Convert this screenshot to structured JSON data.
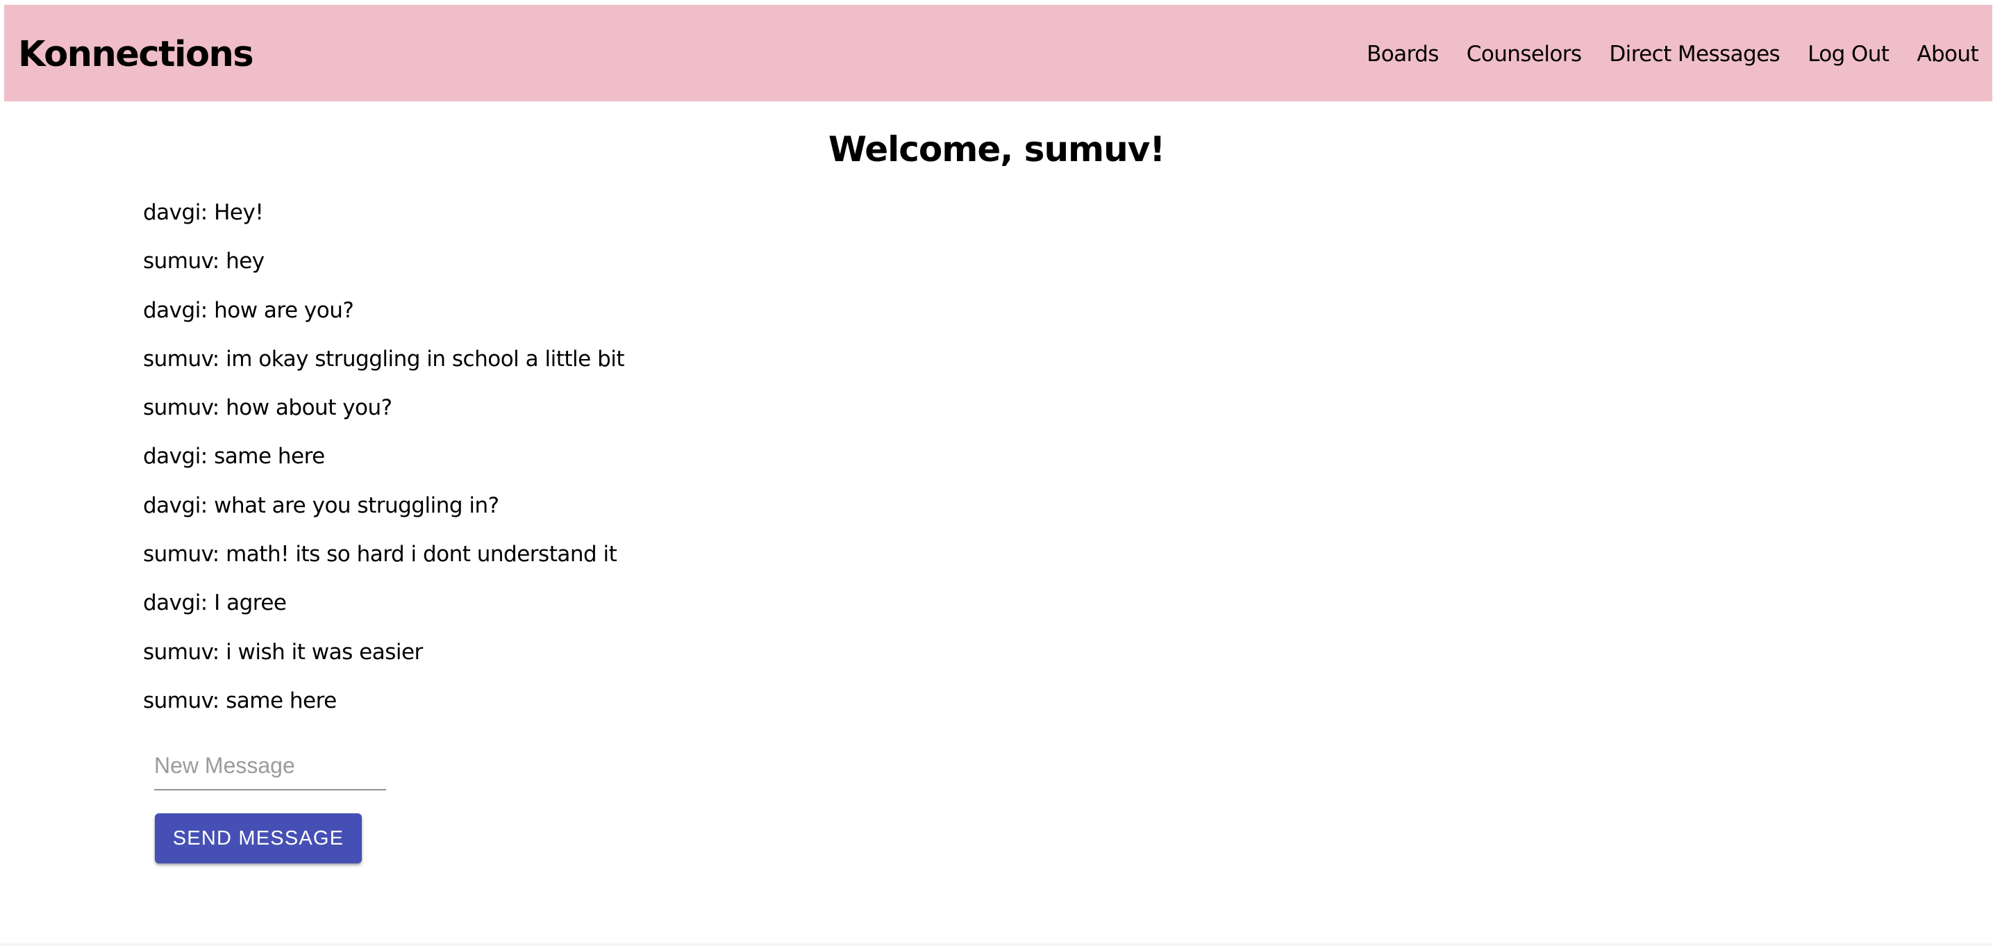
{
  "header": {
    "brand": "Konnections",
    "nav": [
      {
        "label": "Boards"
      },
      {
        "label": "Counselors"
      },
      {
        "label": "Direct Messages"
      },
      {
        "label": "Log Out"
      },
      {
        "label": "About"
      }
    ],
    "background_color": "#f0bec8"
  },
  "main": {
    "welcome": "Welcome, sumuv!",
    "messages": [
      {
        "text": "davgi: Hey!"
      },
      {
        "text": "sumuv: hey"
      },
      {
        "text": "davgi: how are you?"
      },
      {
        "text": "sumuv: im okay struggling in school a little bit"
      },
      {
        "text": "sumuv: how about you?"
      },
      {
        "text": "davgi: same here"
      },
      {
        "text": "davgi: what are you struggling in?"
      },
      {
        "text": "sumuv: math! its so hard i dont understand it"
      },
      {
        "text": "davgi: I agree"
      },
      {
        "text": "sumuv: i wish it was easier"
      },
      {
        "text": "sumuv: same here"
      }
    ]
  },
  "composer": {
    "input_value": "",
    "placeholder": "New Message",
    "send_label": "SEND MESSAGE",
    "button_color": "#4650b4"
  }
}
